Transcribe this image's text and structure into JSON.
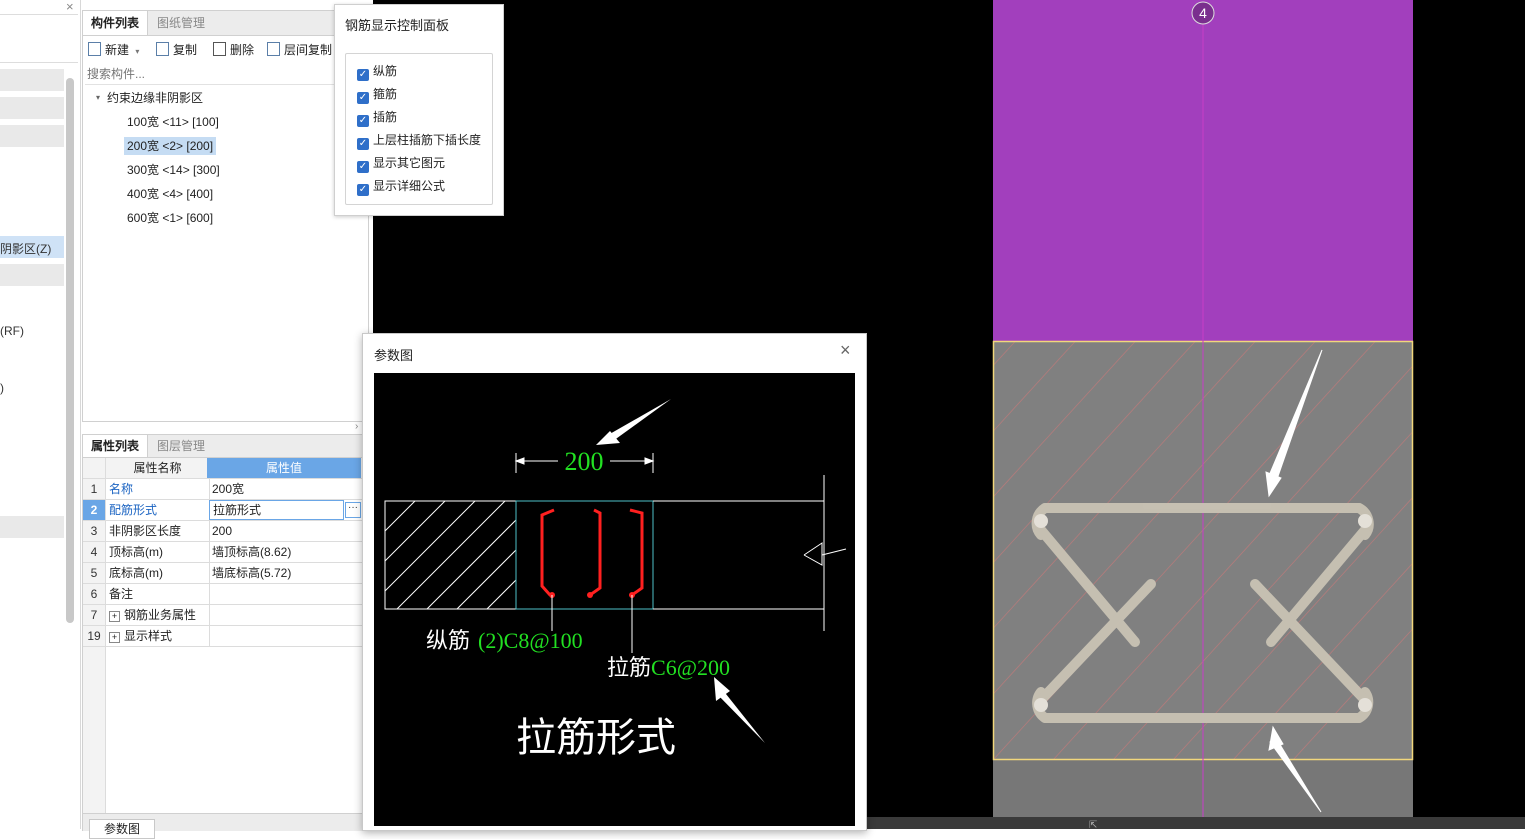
{
  "left_strip": {
    "close_glyph": "×",
    "items": [
      "阴影区(Z)",
      "(RF)",
      ")"
    ]
  },
  "component_panel": {
    "tabs": [
      "构件列表",
      "图纸管理"
    ],
    "toolbar": {
      "new": "新建",
      "copy": "复制",
      "delete": "删除",
      "floor_copy": "层间复制"
    },
    "search_placeholder": "搜索构件...",
    "tree": {
      "root": "约束边缘非阴影区",
      "items": [
        "100宽 <11> [100]",
        "200宽 <2> [200]",
        "300宽 <14> [300]",
        "400宽 <4> [400]",
        "600宽 <1> [600]"
      ],
      "selected_index": 1
    }
  },
  "property_panel": {
    "tabs": [
      "属性列表",
      "图层管理"
    ],
    "headers": {
      "name": "属性名称",
      "value": "属性值"
    },
    "rows": [
      {
        "num": "1",
        "name": "名称",
        "value": "200宽"
      },
      {
        "num": "2",
        "name": "配筋形式",
        "value": "拉筋形式"
      },
      {
        "num": "3",
        "name": "非阴影区长度",
        "value": "200"
      },
      {
        "num": "4",
        "name": "顶标高(m)",
        "value": "墙顶标高(8.62)"
      },
      {
        "num": "5",
        "name": "底标高(m)",
        "value": "墙底标高(5.72)"
      },
      {
        "num": "6",
        "name": "备注",
        "value": ""
      },
      {
        "num": "7",
        "name": "钢筋业务属性",
        "value": ""
      },
      {
        "num": "19",
        "name": "显示样式",
        "value": ""
      }
    ],
    "bottom_tab": "参数图"
  },
  "control_panel": {
    "title": "钢筋显示控制面板",
    "options": [
      "纵筋",
      "箍筋",
      "插筋",
      "上层柱插筋下插长度",
      "显示其它图元",
      "显示详细公式"
    ]
  },
  "param_dialog": {
    "title": "参数图",
    "close_glyph": "×",
    "dimension": "200",
    "longitudinal_label": "纵筋",
    "longitudinal_value": "(2)C8@100",
    "tie_label": "拉筋",
    "tie_value": "C6@200",
    "caption": "拉筋形式"
  },
  "cad": {
    "axis_label": "4",
    "colors": {
      "wall": "#a23fbd",
      "zone": "#808080",
      "axis": "#c83cc8",
      "highlight": "#f2d77c"
    }
  }
}
